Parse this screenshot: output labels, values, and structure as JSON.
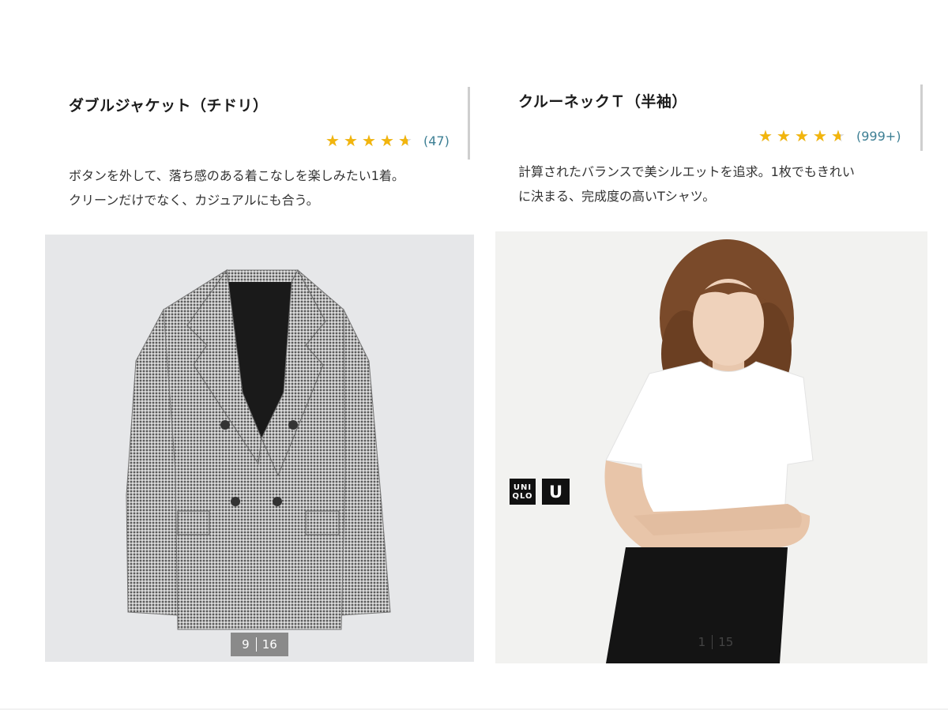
{
  "products": [
    {
      "title": "ダブルジャケット（チドリ）",
      "rating": 4.5,
      "review_count": "(47)",
      "description": [
        "ボタンを外して、落ち感のある着こなしを楽しみたい1着。",
        "クリーンだけでなく、カジュアルにも合う。"
      ],
      "image": "houndstooth-double-breasted-jacket",
      "pager": {
        "current": "9",
        "total": "16"
      }
    },
    {
      "title": "クルーネックＴ（半袖）",
      "rating": 4.5,
      "review_count": "(999+)",
      "description": [
        "計算されたバランスで美シルエットを追求。1枚でもきれい",
        "に決まる、完成度の高いTシャツ。"
      ],
      "image": "model-in-white-crew-neck-tshirt",
      "logos": {
        "uniqlo": [
          "UNI",
          "QLO"
        ],
        "u": "U"
      },
      "pager": {
        "current": "1",
        "total": "15"
      }
    }
  ],
  "colors": {
    "star": "#f2b50d",
    "count": "#3d7f94",
    "image_bg_left": "#e6e7e9",
    "image_bg_right": "#f2f2f0"
  }
}
